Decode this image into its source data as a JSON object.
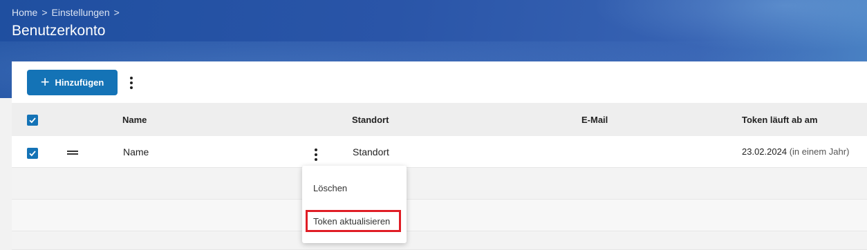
{
  "header": {
    "breadcrumb": [
      "Home",
      "Einstellungen"
    ],
    "separator": ">",
    "title": "Benutzerkonto"
  },
  "toolbar": {
    "add_label": "Hinzufügen",
    "add_icon": "plus-icon",
    "more_icon": "more-vertical-icon"
  },
  "table": {
    "columns": [
      "Name",
      "Standort",
      "E-Mail",
      "Token läuft ab am"
    ],
    "rows": [
      {
        "selected": true,
        "name": "Name",
        "standort": "Standort",
        "email": "",
        "token_expires": "23.02.2024",
        "token_relative": "(in einem Jahr)"
      }
    ]
  },
  "context_menu": {
    "items": [
      "Löschen",
      "Token aktualisieren"
    ],
    "highlighted": "Token aktualisieren"
  },
  "colors": {
    "accent": "#1473b6",
    "header_blue": "#2a55a8",
    "highlight_red": "#e01d25"
  }
}
